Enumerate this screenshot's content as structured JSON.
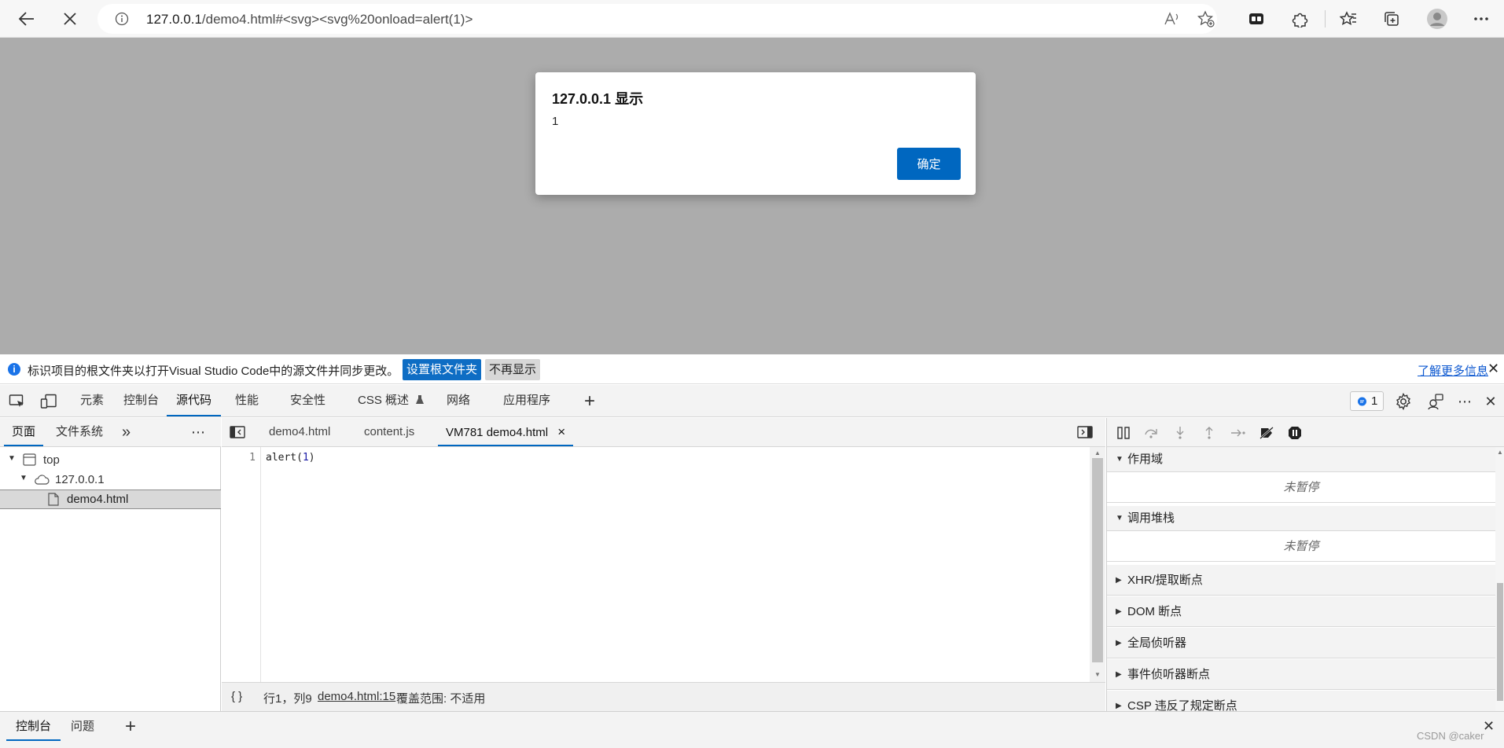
{
  "browser": {
    "url_host": "127.0.0.1",
    "url_rest": "/demo4.html#<svg><svg%20onload=alert(1)>"
  },
  "alert": {
    "title": "127.0.0.1 显示",
    "message": "1",
    "ok_label": "确定"
  },
  "infobar": {
    "icon": "i",
    "text": "标识项目的根文件夹以打开Visual Studio Code中的源文件并同步更改。",
    "set_root_label": "设置根文件夹",
    "dismiss_label": "不再显示",
    "learn_more_label": "了解更多信息",
    "close": "✕"
  },
  "devtools": {
    "tabs": [
      "元素",
      "控制台",
      "源代码",
      "性能",
      "安全性",
      "CSS 概述",
      "网络",
      "应用程序"
    ],
    "active_tab": "源代码",
    "issues_count": "1",
    "add_tab": "+",
    "close": "✕",
    "more": "⋯"
  },
  "navigator": {
    "tabs": [
      "页面",
      "文件系统"
    ],
    "more_tabs": "»",
    "menu": "⋯",
    "tree": [
      "top",
      "127.0.0.1",
      "demo4.html"
    ]
  },
  "editor": {
    "tabs": [
      "demo4.html",
      "content.js",
      "VM781 demo4.html"
    ],
    "close_tab": "×",
    "line_number": "1",
    "code_fn": "alert(",
    "code_arg": "1",
    "code_close": ")",
    "status_format": "{ }",
    "status_position": "行1，列9",
    "status_link": "demo4.html:15",
    "status_coverage": "覆盖范围: 不适用"
  },
  "debugger": {
    "sections": [
      "作用域",
      "调用堆栈",
      "XHR/提取断点",
      "DOM 断点",
      "全局侦听器",
      "事件侦听器断点",
      "CSP 违反了规定断点"
    ],
    "not_paused": "未暂停"
  },
  "drawer": {
    "tabs": [
      "控制台",
      "问题"
    ],
    "add": "+",
    "close": "✕"
  },
  "watermark": "CSDN @caker",
  "colors": {
    "accent": "#0067c0",
    "viewport_bg": "#acacac"
  }
}
